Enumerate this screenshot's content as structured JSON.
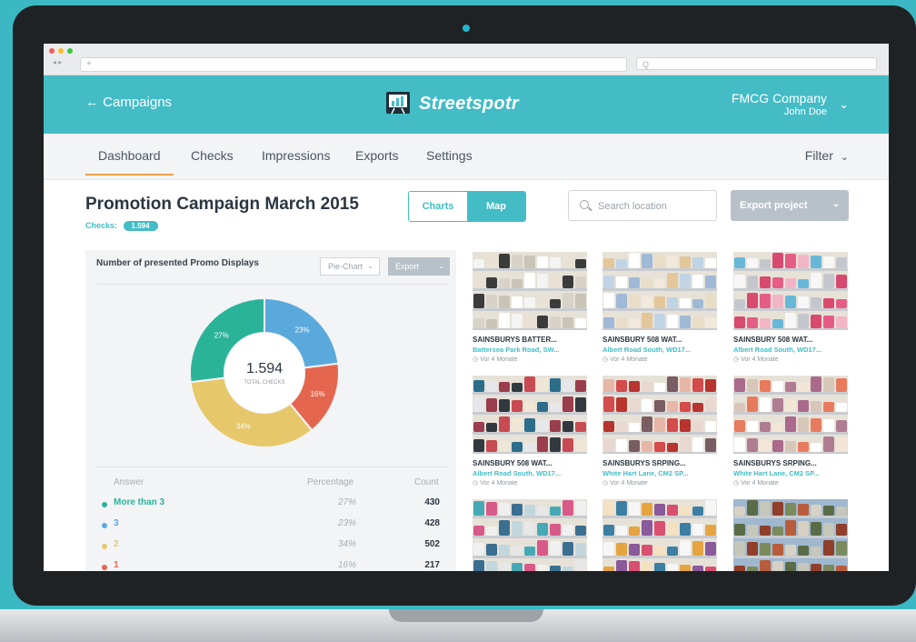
{
  "browser": {
    "search_placeholder": "Q"
  },
  "header": {
    "back_label": "← Campaigns",
    "logo_text": "Streetspotr",
    "company_name": "FMCG Company",
    "user_name": "John Doe"
  },
  "tabs": [
    {
      "label": "Dashboard",
      "active": true
    },
    {
      "label": "Checks"
    },
    {
      "label": "Impressions"
    },
    {
      "label": "Exports"
    },
    {
      "label": "Settings"
    }
  ],
  "filter_label": "Filter",
  "page": {
    "title": "Promotion Campaign March 2015",
    "checks_label": "Checks:",
    "checks_value": "1.594"
  },
  "view_toggle": {
    "charts": "Charts",
    "map": "Map"
  },
  "search": {
    "placeholder": "Search location"
  },
  "export_project_label": "Export project",
  "chart_panel": {
    "title": "Number of presented Promo Displays",
    "type_select": "Pie-Chart",
    "export_label": "Export",
    "center_value": "1.594",
    "center_label": "TOTAL CHECKS",
    "table_headers": {
      "answer": "Answer",
      "percentage": "Percentage",
      "count": "Count"
    }
  },
  "chart_data": {
    "type": "pie",
    "style": "donut",
    "title": "Number of presented Promo Displays",
    "slices": [
      {
        "label": "More than 3",
        "percent": 27,
        "count": 430,
        "color": "#2bb39a"
      },
      {
        "label": "3",
        "percent": 23,
        "count": 428,
        "color": "#5aa9dc"
      },
      {
        "label": "2",
        "percent": 34,
        "count": 502,
        "color": "#e6c76a"
      },
      {
        "label": "1",
        "percent": 16,
        "count": 217,
        "color": "#e5664f"
      }
    ],
    "slice_labels": [
      "27%",
      "23%",
      "34%",
      "16%"
    ],
    "table_rows": [
      {
        "answer": "More than 3",
        "percentage": "27%",
        "count": "430"
      },
      {
        "answer": "3",
        "percentage": "23%",
        "count": "428"
      },
      {
        "answer": "2",
        "percentage": "34%",
        "count": "502"
      },
      {
        "answer": "1",
        "percentage": "16%",
        "count": "217"
      }
    ]
  },
  "photos": [
    {
      "title": "SAINSBURYS BATTER...",
      "address": "Battersea Park Road, SW...",
      "time": "Vor 4 Monate"
    },
    {
      "title": "SAINSBURY 508 WAT...",
      "address": "Albert Road South, WD17...",
      "time": "Vor 4 Monate"
    },
    {
      "title": "SAINSBURY 508 WAT...",
      "address": "Albert Road South, WD17...",
      "time": "Vor 4 Monate"
    },
    {
      "title": "SAINSBURY 508 WAT...",
      "address": "Albert Road South, WD17...",
      "time": "Vor 4 Monate"
    },
    {
      "title": "SAINSBURYS SRPING...",
      "address": "White Hart Lane, CM2 SP...",
      "time": "Vor 4 Monate"
    },
    {
      "title": "SAINSBURYS SRPING...",
      "address": "White Hart Lane, CM2 SP...",
      "time": "Vor 4 Monate"
    }
  ],
  "colors": {
    "accent": "#43bcc6",
    "tab_underline": "#f0a14a"
  }
}
